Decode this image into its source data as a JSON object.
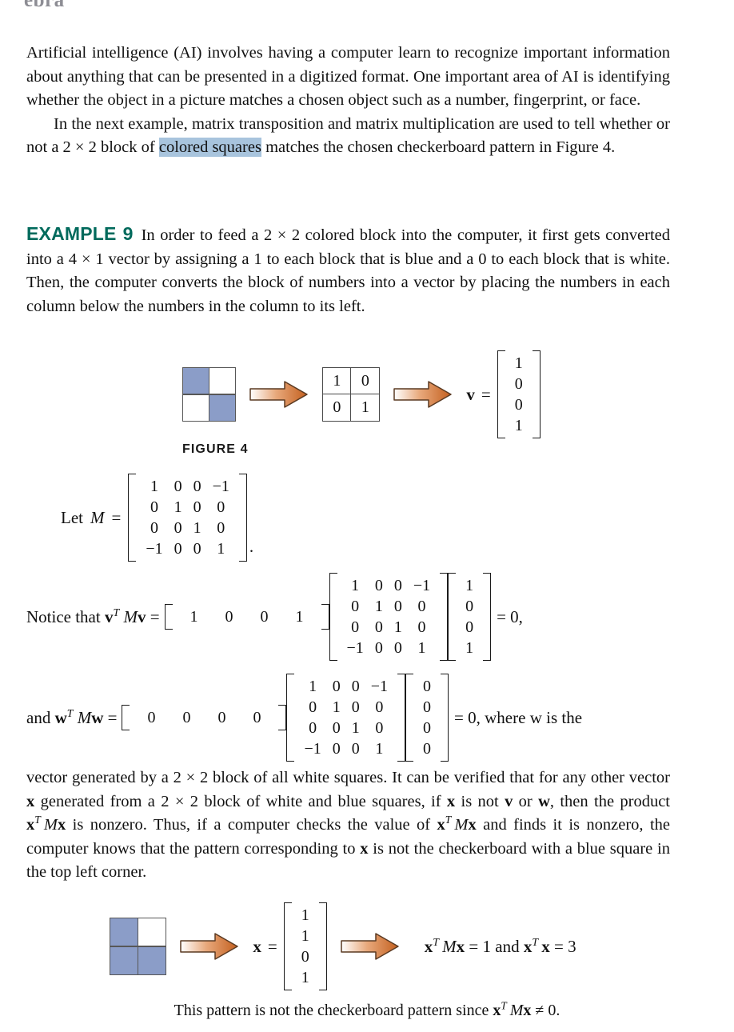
{
  "running_head": "ebra",
  "paragraphs": {
    "p1_a": "Artificial intelligence (AI) involves having a computer learn to recognize important information about anything that can be presented in a digitized format. One important area of AI is identifying whether the object in a picture matches a chosen object such as a number, fingerprint, or face.",
    "p2_pre": "In the next example, matrix transposition and matrix multiplication are used to tell whether or not a 2 × 2 block of ",
    "p2_highlight": "colored squares",
    "p2_post": " matches the chosen checkerboard pattern in Figure 4."
  },
  "example": {
    "tag": "EXAMPLE 9",
    "text": "In order to feed a 2 × 2 colored block into the computer, it first gets converted into a 4 × 1 vector by assigning a 1 to each block that is blue and a 0 to each block that is white. Then, the computer converts the block of numbers into a vector by placing the numbers in each column below the numbers in the column to its left."
  },
  "figure4": {
    "caption": "FIGURE 4",
    "block_colors": [
      "blue",
      "white",
      "white",
      "blue"
    ],
    "number_grid": [
      "1",
      "0",
      "0",
      "1"
    ],
    "vector_label": "v",
    "equals": "=",
    "vector_values": [
      "1",
      "0",
      "0",
      "1"
    ]
  },
  "let_m": {
    "label": "Let",
    "symbol": "M",
    "equals": "=",
    "matrix": [
      [
        "1",
        "0",
        "0",
        "−1"
      ],
      [
        "0",
        "1",
        "0",
        "0"
      ],
      [
        "0",
        "0",
        "1",
        "0"
      ],
      [
        "−1",
        "0",
        "0",
        "1"
      ]
    ],
    "trailing_period": "."
  },
  "equation_v": {
    "lead_text": "Notice that",
    "expr_v": "v",
    "expr_T": "T",
    "expr_M": "M",
    "expr_v2": "v",
    "equals": "=",
    "row_vector": [
      "1",
      "0",
      "0",
      "1"
    ],
    "matrix": [
      [
        "1",
        "0",
        "0",
        "−1"
      ],
      [
        "0",
        "1",
        "0",
        "0"
      ],
      [
        "0",
        "0",
        "1",
        "0"
      ],
      [
        "−1",
        "0",
        "0",
        "1"
      ]
    ],
    "col_vector": [
      "1",
      "0",
      "0",
      "1"
    ],
    "result": "= 0,"
  },
  "equation_w": {
    "lead_text": "and",
    "expr_w": "w",
    "expr_T": "T",
    "expr_M": "M",
    "expr_w2": "w",
    "equals": "=",
    "row_vector": [
      "0",
      "0",
      "0",
      "0"
    ],
    "matrix": [
      [
        "1",
        "0",
        "0",
        "−1"
      ],
      [
        "0",
        "1",
        "0",
        "0"
      ],
      [
        "0",
        "0",
        "1",
        "0"
      ],
      [
        "−1",
        "0",
        "0",
        "1"
      ]
    ],
    "col_vector": [
      "0",
      "0",
      "0",
      "0"
    ],
    "result": "= 0, where w is the"
  },
  "after_equations": {
    "part1": "vector generated by a 2 × 2 block of all white squares. It can be verified that for any other vector ",
    "x1": "x",
    "part2": " generated from a 2 × 2 block of white and blue squares, if ",
    "x2": "x",
    "part3": " is not ",
    "v1": "v",
    "part4": " or ",
    "w1": "w",
    "part5": ", then the product ",
    "expr1_x": "x",
    "expr1_T": "T",
    "expr1_M": "M",
    "expr1_x2": "x",
    "part6": " is nonzero. Thus, if a computer checks the value of ",
    "expr2_x": "x",
    "expr2_T": "T",
    "expr2_M": "M",
    "expr2_x2": "x",
    "part7": " and finds it is nonzero, the computer knows that the pattern corresponding to ",
    "x3": "x",
    "part8": " is not the checkerboard with a blue square in the top left corner."
  },
  "figure_bottom": {
    "block_colors": [
      "blue",
      "white",
      "blue",
      "blue"
    ],
    "vector_label": "x",
    "equals": "=",
    "vector_values": [
      "1",
      "1",
      "0",
      "1"
    ],
    "result_x": "x",
    "result_T": "T",
    "result_M": "M",
    "result_x2": "x",
    "result_eq1": "= 1",
    "result_and": "and",
    "result2_x": "x",
    "result2_T": "T",
    "result2_x2": "x",
    "result_eq2": "= 3",
    "note_pre": "This pattern is not the checkerboard pattern since ",
    "note_x": "x",
    "note_T": "T",
    "note_M": "M",
    "note_x2": "x",
    "note_post": " ≠ 0."
  },
  "colors": {
    "block_blue": "#8b9dc8",
    "highlight": "#a8c4dd",
    "example_green": "#006a5c",
    "arrow_orange": "#c4601f",
    "text": "#111111"
  }
}
